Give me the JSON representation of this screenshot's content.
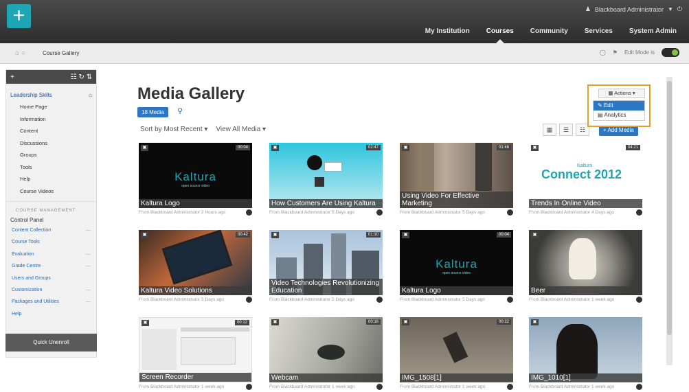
{
  "topbar": {
    "user": "Blackboard Administrator",
    "nav": [
      "My Institution",
      "Courses",
      "Community",
      "Services",
      "System Admin"
    ],
    "active_nav": "Courses"
  },
  "breadcrumb": {
    "current": "Course Gallery",
    "edit_mode_label": "Edit Mode is"
  },
  "left_panel": {
    "course_name": "Leadership Skills",
    "menu": [
      "Home Page",
      "Information",
      "Content",
      "Discussions",
      "Groups",
      "Tools",
      "Help",
      "Course Videos"
    ],
    "section_label": "COURSE MANAGEMENT",
    "control_panel": "Control Panel",
    "tools": [
      "Content Collection",
      "Course Tools",
      "Evaluation",
      "Grade Centre",
      "Users and Groups",
      "Customization",
      "Packages and Utilities",
      "Help"
    ],
    "quick_unenroll": "Quick Unenroll"
  },
  "main": {
    "title": "Media Gallery",
    "media_count": "18 Media",
    "sort_label": "Sort by Most Recent",
    "view_label": "View All Media",
    "add_media": "Add Media",
    "actions": {
      "button": "Actions",
      "items": [
        "Edit",
        "Analytics"
      ]
    }
  },
  "media": [
    {
      "title": "Kaltura Logo",
      "duration": "00:04",
      "meta": "From Blackboard Administrator 2 Hours ago"
    },
    {
      "title": "How Customers Are Using Kaltura",
      "duration": "02:47",
      "meta": "From Blackboard Administrator 5 Days ago"
    },
    {
      "title": "Using Video For Effective Marketing",
      "duration": "01:46",
      "meta": "From Blackboard Administrator 5 Days ago"
    },
    {
      "title": "Trends In Online Video",
      "duration": "04:21",
      "meta": "From Blackboard Administrator 4 Days ago"
    },
    {
      "title": "Kaltura Video Solutions",
      "duration": "00:42",
      "meta": "From Blackboard Administrator 5 Days ago"
    },
    {
      "title": "Video Technologies Revolutionizing Education",
      "duration": "01:10",
      "meta": "From Blackboard Administrator 5 Days ago"
    },
    {
      "title": "Kaltura Logo",
      "duration": "00:04",
      "meta": "From Blackboard Administrator 5 Days ago"
    },
    {
      "title": "Beer",
      "duration": "",
      "meta": "From Blackboard Administrator 1 week ago"
    },
    {
      "title": "Screen Recorder",
      "duration": "00:12",
      "meta": "From Blackboard Administrator 1 week ago"
    },
    {
      "title": "Webcam",
      "duration": "00:16",
      "meta": "From Blackboard Administrator 1 week ago"
    },
    {
      "title": "IMG_1508[1]",
      "duration": "00:22",
      "meta": "From Blackboard Administrator 1 week ago"
    },
    {
      "title": "IMG_1010[1]",
      "duration": "",
      "meta": "From Blackboard Administrator 1 week ago"
    }
  ],
  "thumb_text": {
    "kaltura": "Kaltura",
    "kaltura_sub": "open source video",
    "connect": "Connect 2012",
    "connect_small": "Kaltura"
  }
}
